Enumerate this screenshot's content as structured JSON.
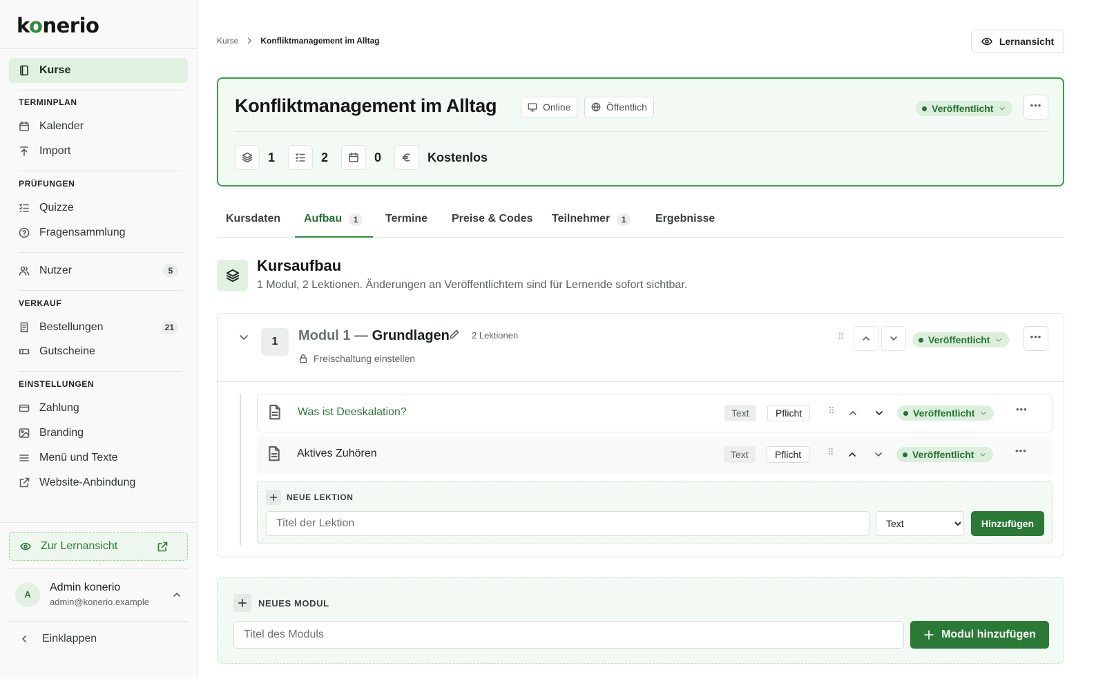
{
  "brand": {
    "logo_pre": "k",
    "logo_o": "o",
    "logo_post": "nerio"
  },
  "sidebar": {
    "active_item": "Kurse",
    "sections": [
      {
        "title": "TERMINPLAN",
        "items": [
          "Kalender",
          "Import"
        ]
      },
      {
        "title": "PRÜFUNGEN",
        "items": [
          "Quizze",
          "Fragensammlung"
        ]
      },
      {
        "title": "VERKAUF",
        "items": [
          "Bestellungen",
          "Gutscheine"
        ]
      },
      {
        "title": "EINSTELLUNGEN",
        "items": [
          "Zahlung",
          "Branding",
          "Menü und Texte",
          "Website-Anbindung"
        ]
      }
    ],
    "users_label": "Nutzer",
    "users_count": "5",
    "orders_count": "21",
    "learn_view_label": "Zur Lernansicht",
    "user": {
      "initial": "A",
      "name": "Admin konerio",
      "email": "admin@konerio.example"
    },
    "collapse_label": "Einklappen"
  },
  "breadcrumb": {
    "parent": "Kurse",
    "current": "Konfliktmanagement im Alltag"
  },
  "top_button": "Lernansicht",
  "course": {
    "title": "Konfliktmanagement im Alltag",
    "tag_mode": "Online",
    "tag_visibility": "Öffentlich",
    "status": "Veröffentlicht",
    "stats": {
      "modules": "1",
      "lessons": "2",
      "dates": "0",
      "price": "Kostenlos"
    }
  },
  "tabs": [
    {
      "label": "Kursdaten",
      "count": ""
    },
    {
      "label": "Aufbau",
      "count": "1"
    },
    {
      "label": "Termine",
      "count": ""
    },
    {
      "label": "Preise & Codes",
      "count": ""
    },
    {
      "label": "Teilnehmer",
      "count": "1"
    },
    {
      "label": "Ergebnisse",
      "count": ""
    }
  ],
  "structure": {
    "title": "Kursaufbau",
    "subtitle": "1 Modul, 2 Lektionen. Änderungen an Veröffentlichtem sind für Lernende sofort sichtbar."
  },
  "module": {
    "number": "1",
    "title_prefix": "Modul 1 —",
    "title_name": "Grundlagen",
    "lesson_count": "2 Lektionen",
    "unlock_label": "Freischaltung einstellen",
    "status": "Veröffentlicht",
    "lessons": [
      {
        "title": "Was ist Deeskalation?",
        "type": "Text",
        "required": "Pflicht",
        "status": "Veröffentlicht"
      },
      {
        "title": "Aktives Zuhören",
        "type": "Text",
        "required": "Pflicht",
        "status": "Veröffentlicht"
      }
    ],
    "new_lesson": {
      "heading": "NEUE LEKTION",
      "placeholder": "Titel der Lektion",
      "type_selected": "Text",
      "submit": "Hinzufügen"
    }
  },
  "new_module": {
    "heading": "NEUES MODUL",
    "placeholder": "Titel des Moduls",
    "submit": "Modul hinzufügen"
  },
  "colors": {
    "accent": "#2a7a36",
    "accent_light": "#e1f1e1",
    "card_border": "#35a048"
  }
}
